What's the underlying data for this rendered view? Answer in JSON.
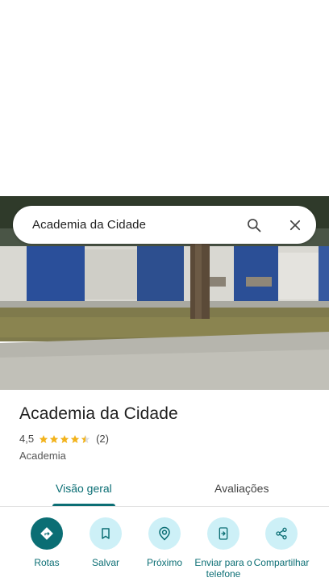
{
  "search": {
    "query": "Academia da Cidade"
  },
  "place": {
    "title": "Academia da Cidade",
    "rating_value": "4,5",
    "rating_stars": 4.5,
    "review_count": "(2)",
    "category": "Academia"
  },
  "tabs": [
    {
      "label": "Visão geral",
      "selected": true
    },
    {
      "label": "Avaliações",
      "selected": false
    }
  ],
  "actions": [
    {
      "label": "Rotas",
      "icon": "directions-icon"
    },
    {
      "label": "Salvar",
      "icon": "bookmark-icon"
    },
    {
      "label": "Próximo",
      "icon": "nearby-icon"
    },
    {
      "label": "Enviar para o telefone",
      "icon": "send-to-phone-icon"
    },
    {
      "label": "Compartilhar",
      "icon": "share-icon"
    }
  ],
  "colors": {
    "accent": "#0b6e74",
    "action_bg": "#cdf0f7",
    "star": "#f2b31c"
  }
}
